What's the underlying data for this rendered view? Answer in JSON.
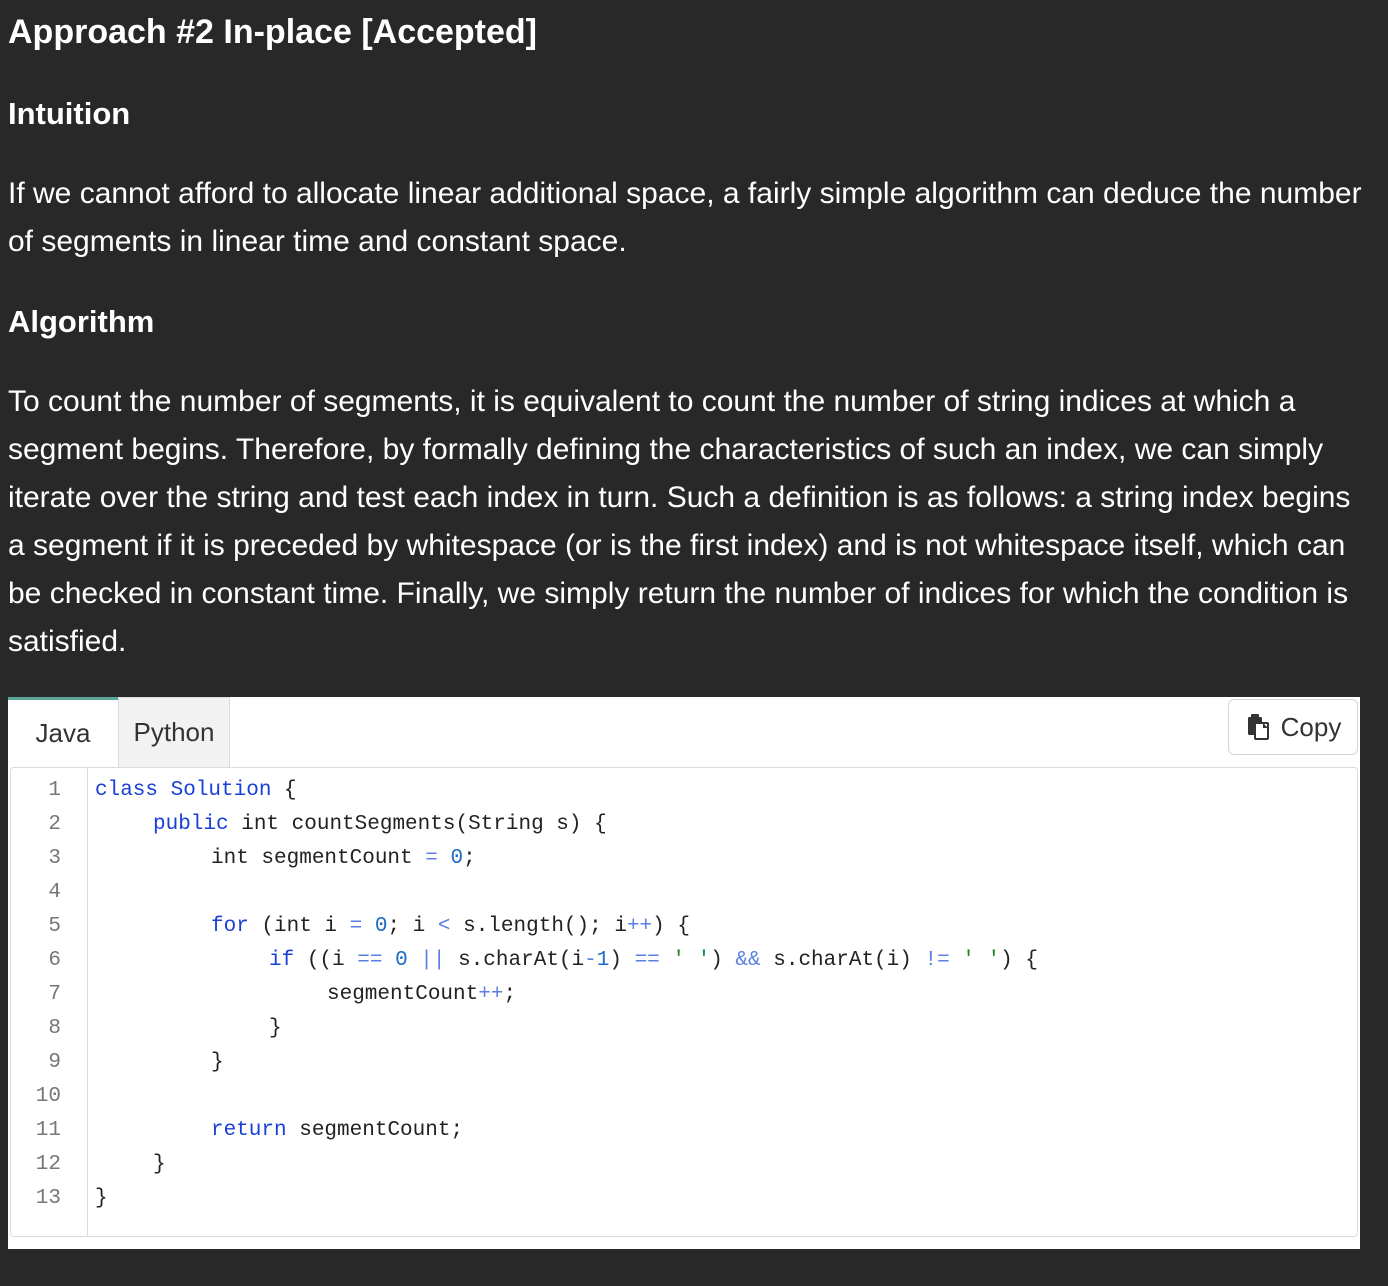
{
  "article": {
    "title": "Approach #2 In-place [Accepted]",
    "intuition_heading": "Intuition",
    "intuition_text": "If we cannot afford to allocate linear additional space, a fairly simple algorithm can deduce the number of segments in linear time and constant space.",
    "algorithm_heading": "Algorithm",
    "algorithm_text": "To count the number of segments, it is equivalent to count the number of string indices at which a segment begins. Therefore, by formally defining the characteristics of such an index, we can simply iterate over the string and test each index in turn. Such a definition is as follows: a string index begins a segment if it is preceded by whitespace (or is the first index) and is not whitespace itself, which can be checked in constant time. Finally, we simply return the number of indices for which the condition is satisfied."
  },
  "code": {
    "tabs": [
      "Java",
      "Python"
    ],
    "active_tab": "Java",
    "copy_label": "Copy",
    "copy_icon": "clipboard-icon",
    "line_numbers": [
      "1",
      "2",
      "3",
      "4",
      "5",
      "6",
      "7",
      "8",
      "9",
      "10",
      "11",
      "12",
      "13"
    ],
    "tokens": {
      "l1_kw": "class",
      "l1_cls": "Solution",
      "l1_rest": " {",
      "l2_kw": "public",
      "l2_rest": " int countSegments(String s) {",
      "l3_a": "int segmentCount ",
      "l3_op": "=",
      "l3_sp": " ",
      "l3_num": "0",
      "l3_end": ";",
      "l5_kw": "for",
      "l5_a": " (int i ",
      "l5_op1": "=",
      "l5_sp1": " ",
      "l5_num1": "0",
      "l5_b": "; i ",
      "l5_op2": "<",
      "l5_c": " s.length(); i",
      "l5_op3": "++",
      "l5_d": ") {",
      "l6_kw": "if",
      "l6_a": " ((i ",
      "l6_op1": "==",
      "l6_sp1": " ",
      "l6_num1": "0",
      "l6_sp2": " ",
      "l6_op2": "||",
      "l6_b": " s.charAt(i",
      "l6_op3": "-",
      "l6_num2": "1",
      "l6_c": ") ",
      "l6_op4": "==",
      "l6_sp3": " ",
      "l6_str1": "' '",
      "l6_d": ") ",
      "l6_op5": "&&",
      "l6_e": " s.charAt(i) ",
      "l6_op6": "!=",
      "l6_sp4": " ",
      "l6_str2": "' '",
      "l6_f": ") {",
      "l7_a": "segmentCount",
      "l7_op": "++",
      "l7_end": ";",
      "l8": "}",
      "l9": "}",
      "l11_kw": "return",
      "l11_rest": " segmentCount;",
      "l12": "}",
      "l13": "}"
    }
  }
}
